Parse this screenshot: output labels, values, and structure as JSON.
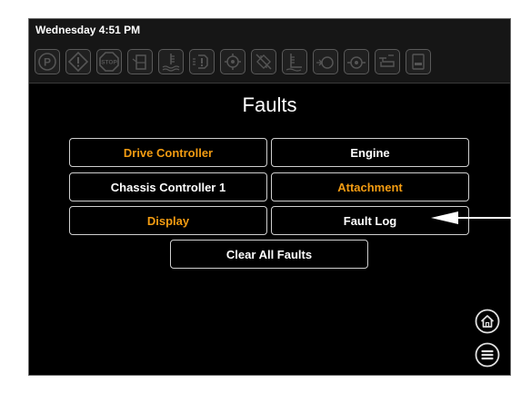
{
  "status_bar": {
    "datetime": "Wednesday 4:51 PM",
    "indicators": [
      "parking-brake-icon",
      "warning-icon",
      "stop-icon",
      "fuel-level-icon",
      "coolant-temp-icon",
      "hydraulic-icon",
      "transmission-icon",
      "filter-icon",
      "oil-level-icon",
      "fuel-filter-icon",
      "oil-pressure-icon",
      "engine-icon",
      "def-icon"
    ],
    "indicator_labels": {
      "parking": "P",
      "stop": "STOP"
    }
  },
  "page": {
    "title": "Faults"
  },
  "buttons": {
    "drive_controller": "Drive Controller",
    "engine": "Engine",
    "chassis_controller_1": "Chassis Controller 1",
    "attachment": "Attachment",
    "display": "Display",
    "fault_log": "Fault Log",
    "clear_all_faults": "Clear All Faults"
  },
  "nav": {
    "home": "home-icon",
    "menu": "menu-icon"
  },
  "colors": {
    "fault_active": "#f39c12",
    "normal": "#ffffff",
    "background": "#000000"
  }
}
